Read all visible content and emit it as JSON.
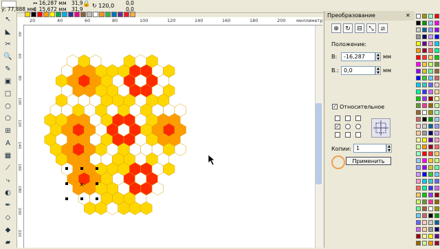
{
  "propbar": {
    "x_value": "77,888 мм",
    "w_value": "16,287 мм",
    "h_value": "15,672 мм",
    "sx_value": "31,9",
    "sy_value": "31,9",
    "angle_value": "120,0",
    "angle2_value": "0,0"
  },
  "ruler": {
    "h_ticks": [
      "20",
      "40",
      "60",
      "80",
      "100",
      "120",
      "140",
      "160",
      "180",
      "200"
    ],
    "unit": "миллиметры",
    "v_ticks": [
      "40",
      "60",
      "80",
      "100",
      "120",
      "140",
      "160",
      "180",
      "200",
      "220"
    ]
  },
  "docker": {
    "title": "Преобразование",
    "position_label": "Положение:",
    "h_label": "В:",
    "h_value": "-16,287",
    "h_unit": "мм",
    "v_label": "В.:",
    "v_value": "0,0",
    "v_unit": "мм",
    "relative_label": "Относительное",
    "copies_label": "Копии:",
    "copies_value": "1",
    "apply_label": "Применить"
  },
  "colors": {
    "yellow": "#ffd700",
    "orange": "#ff9c00",
    "red": "#ff2a00",
    "white": "#ffffff"
  }
}
